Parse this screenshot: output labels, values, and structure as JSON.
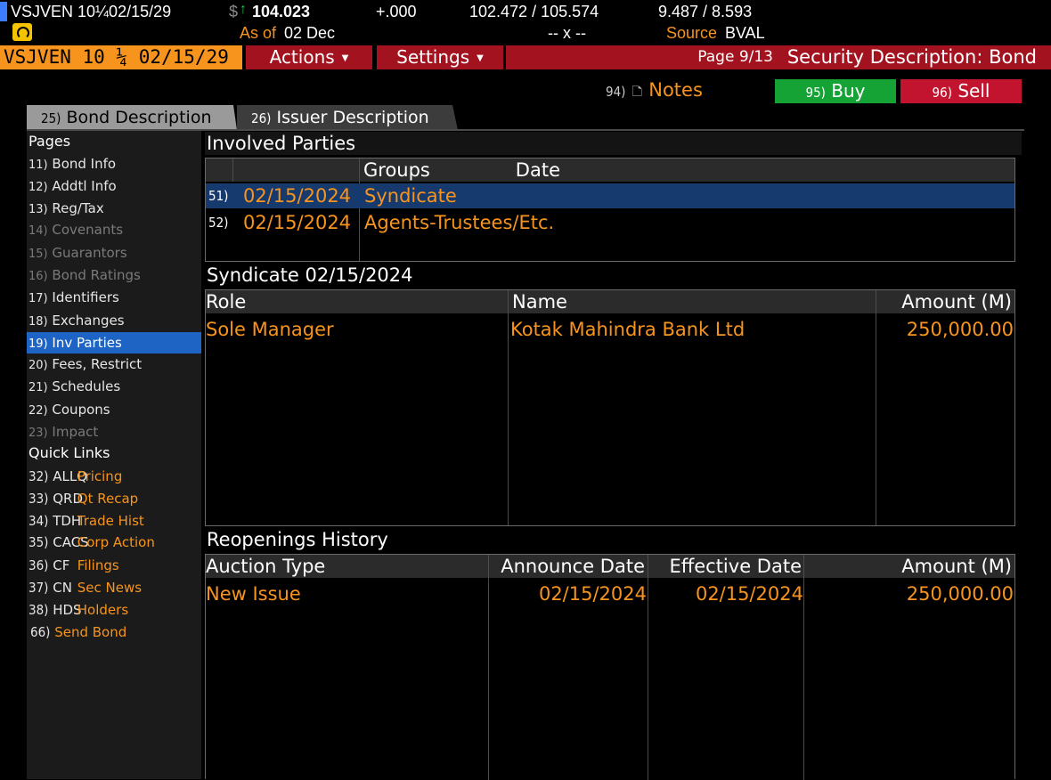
{
  "ticker": {
    "symbol": "VSJVEN 10¼02/15/29",
    "currency_symbol": "$",
    "price": "104.023",
    "change": "+.000",
    "bid_ask": "102.472 / 105.574",
    "yields": "9.487 / 8.593",
    "as_of_label": "As of",
    "as_of_date": "02 Dec",
    "volume": "-- x --",
    "source_label": "Source",
    "source_value": "BVAL"
  },
  "toolbar": {
    "security": "VSJVEN 10 ¼ 02/15/29",
    "actions_label": "Actions",
    "settings_label": "Settings",
    "page_indicator": "Page 9/13",
    "screen_title": "Security Description: Bond"
  },
  "actions": {
    "notes_num": "94)",
    "notes_label": "Notes",
    "buy_num": "95)",
    "buy_label": "Buy",
    "sell_num": "96)",
    "sell_label": "Sell"
  },
  "tabs": [
    {
      "num": "25)",
      "label": "Bond Description"
    },
    {
      "num": "26)",
      "label": "Issuer Description"
    }
  ],
  "sidebar": {
    "pages_heading": "Pages",
    "items": [
      {
        "num": "11)",
        "label": "Bond Info"
      },
      {
        "num": "12)",
        "label": "Addtl Info"
      },
      {
        "num": "13)",
        "label": "Reg/Tax"
      },
      {
        "num": "14)",
        "label": "Covenants"
      },
      {
        "num": "15)",
        "label": "Guarantors"
      },
      {
        "num": "16)",
        "label": "Bond Ratings"
      },
      {
        "num": "17)",
        "label": "Identifiers"
      },
      {
        "num": "18)",
        "label": "Exchanges"
      },
      {
        "num": "19)",
        "label": "Inv Parties"
      },
      {
        "num": "20)",
        "label": "Fees, Restrict"
      },
      {
        "num": "21)",
        "label": "Schedules"
      },
      {
        "num": "22)",
        "label": "Coupons"
      },
      {
        "num": "23)",
        "label": "Impact"
      }
    ],
    "quick_links_heading": "Quick Links",
    "quick_links": [
      {
        "num": "32)",
        "cmd": "ALLQ",
        "label": "Pricing"
      },
      {
        "num": "33)",
        "cmd": "QRD",
        "label": "Qt Recap"
      },
      {
        "num": "34)",
        "cmd": "TDH",
        "label": "Trade Hist"
      },
      {
        "num": "35)",
        "cmd": "CACS",
        "label": "Corp Action"
      },
      {
        "num": "36)",
        "cmd": "CF",
        "label": "Filings"
      },
      {
        "num": "37)",
        "cmd": "CN",
        "label": "Sec News"
      },
      {
        "num": "38)",
        "cmd": "HDS",
        "label": "Holders"
      }
    ],
    "send_num": "66)",
    "send_label": "Send Bond"
  },
  "involved_parties": {
    "title": "Involved Parties",
    "col_date": "Date",
    "col_groups": "Groups",
    "rows": [
      {
        "num": "51)",
        "date": "02/15/2024",
        "group": "Syndicate"
      },
      {
        "num": "52)",
        "date": "02/15/2024",
        "group": "Agents-Trustees/Etc."
      }
    ]
  },
  "syndicate": {
    "title": "Syndicate 02/15/2024",
    "col_role": "Role",
    "col_name": "Name",
    "col_amount": "Amount (M)",
    "rows": [
      {
        "role": "Sole Manager",
        "name": "Kotak Mahindra Bank Ltd",
        "amount": "250,000.00"
      }
    ]
  },
  "reopenings": {
    "title": "Reopenings History",
    "col_auction": "Auction Type",
    "col_announce": "Announce Date",
    "col_effective": "Effective Date",
    "col_amount": "Amount (M)",
    "rows": [
      {
        "auction": "New Issue",
        "announce": "02/15/2024",
        "effective": "02/15/2024",
        "amount": "250,000.00"
      }
    ]
  },
  "colors": {
    "accent_orange": "#f7941d",
    "menu_red": "#a3121f",
    "buy_green": "#15a336",
    "sell_red": "#c2142e",
    "selected_blue": "#1d64c4"
  }
}
